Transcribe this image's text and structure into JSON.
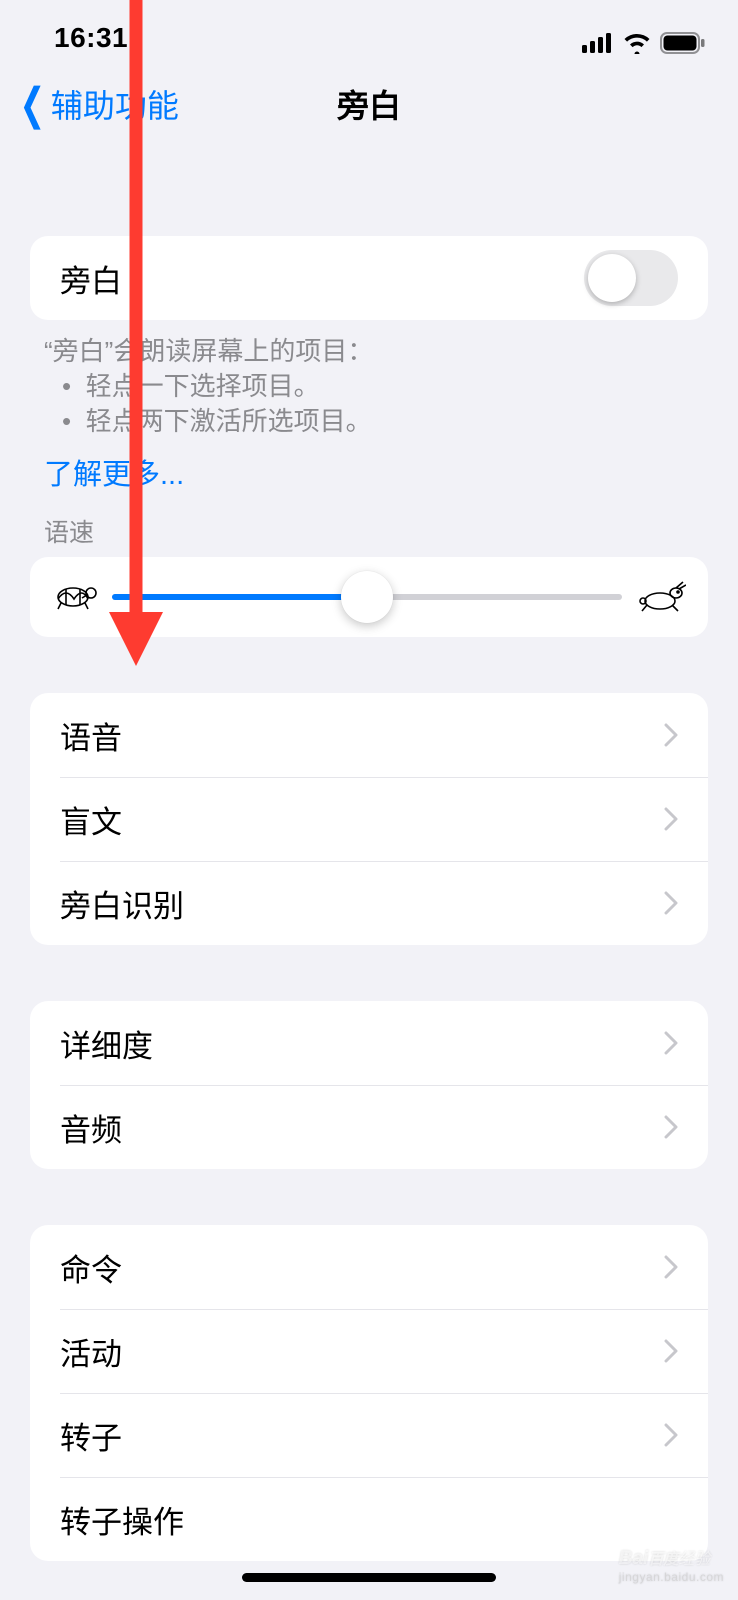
{
  "status": {
    "time": "16:31"
  },
  "nav": {
    "back_label": "辅助功能",
    "title": "旁白"
  },
  "section1": {
    "toggle_label": "旁白",
    "toggle_on": false,
    "footer_intro": "“旁白”会朗读屏幕上的项目：",
    "footer_b1": "轻点一下选择项目。",
    "footer_b2": "轻点两下激活所选项目。",
    "learn_more": "了解更多..."
  },
  "speed": {
    "header": "语速",
    "value_pct": 50
  },
  "group2": {
    "items": [
      "语音",
      "盲文",
      "旁白识别"
    ]
  },
  "group3": {
    "items": [
      "详细度",
      "音频"
    ]
  },
  "group4": {
    "items": [
      "命令",
      "活动",
      "转子",
      "转子操作"
    ]
  },
  "colors": {
    "accent": "#007aff",
    "annotation": "#fe3b30"
  },
  "watermark": {
    "brand": "Bai",
    "brand2": "百度",
    "suffix": "经验",
    "url": "jingyan.baidu.com"
  }
}
